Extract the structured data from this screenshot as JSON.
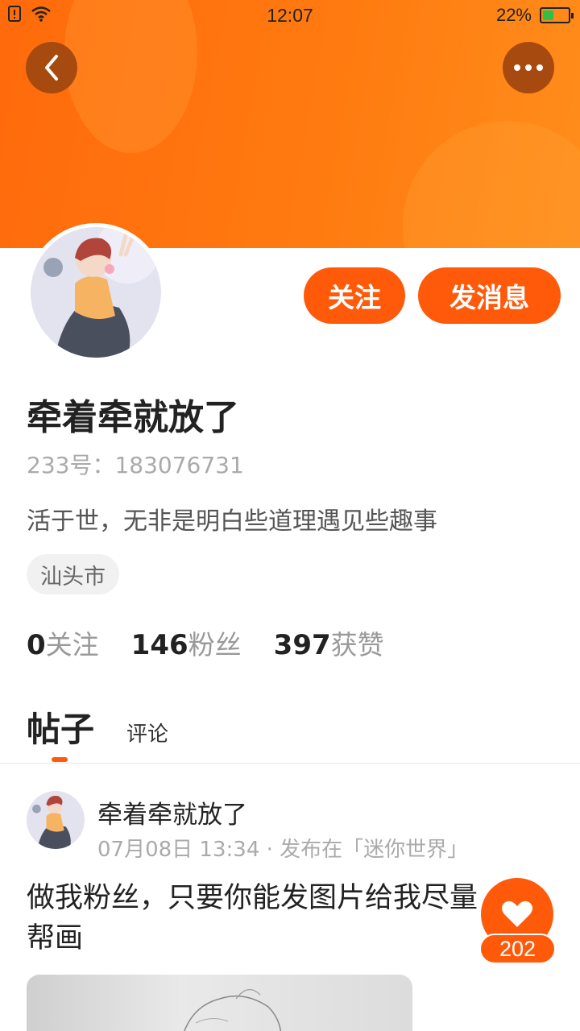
{
  "status_bar": {
    "time": "12:07",
    "battery": "22%",
    "battery_fraction": 0.22
  },
  "colors": {
    "accent": "#ff5a0a",
    "banner": "#ff7a10",
    "battery_fill": "#2fc04a"
  },
  "header": {
    "back_icon": "chevron-left-icon",
    "more_icon": "more-dots-icon"
  },
  "profile": {
    "nickname": "牵着牵就放了",
    "uid_line": "233号：183076731",
    "bio": "活于世，无非是明白些道理遇见些趣事",
    "location": "汕头市",
    "follow_label": "关注",
    "message_label": "发消息"
  },
  "stats": [
    {
      "value": "0",
      "label": "关注"
    },
    {
      "value": "146",
      "label": "粉丝"
    },
    {
      "value": "397",
      "label": "获赞"
    }
  ],
  "tabs": [
    {
      "label": "帖子",
      "active": true
    },
    {
      "label": "评论",
      "active": false
    }
  ],
  "post": {
    "author": "牵着牵就放了",
    "meta": "07月08日 13:34 · 发布在「迷你世界」",
    "text": "做我粉丝，只要你能发图片给我尽量帮画",
    "likes": "202",
    "like_icon": "heart-icon"
  }
}
